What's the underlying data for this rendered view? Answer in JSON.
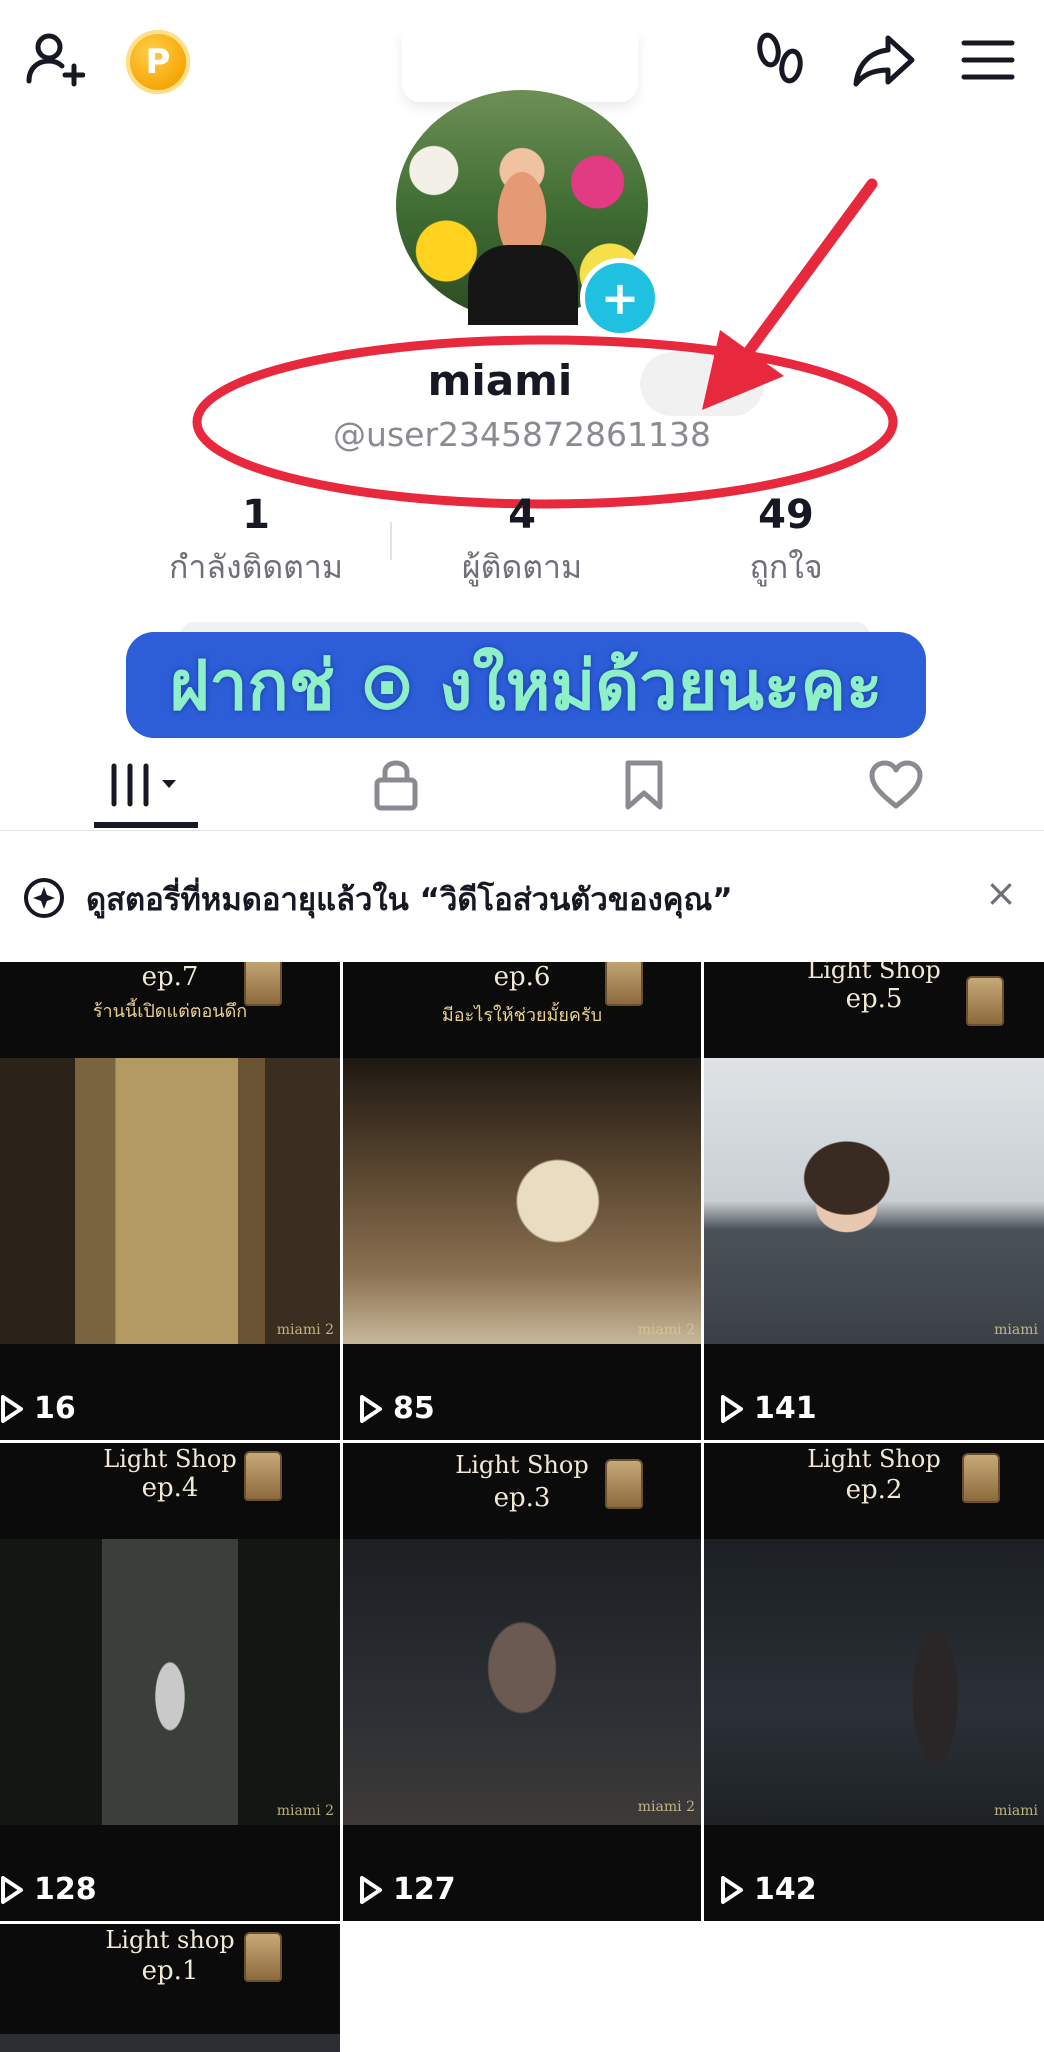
{
  "header": {
    "add_friend_icon": "person-plus-icon",
    "coin_label": "P",
    "footprint_icon": "footprints-icon",
    "share_icon": "share-arrow-icon",
    "menu_icon": "hamburger-menu-icon"
  },
  "profile": {
    "name": "miami",
    "handle": "@user2345872861138",
    "stats": [
      {
        "value": "1",
        "label": "กำลังติดตาม"
      },
      {
        "value": "4",
        "label": "ผู้ติดตาม"
      },
      {
        "value": "49",
        "label": "ถูกใจ"
      }
    ]
  },
  "overlay": {
    "caption": "ฝากช่ ⊙ งใหม่ด้วยนะคะ"
  },
  "tabs": [
    {
      "name": "videos",
      "icon": "grid-icon"
    },
    {
      "name": "private",
      "icon": "lock-icon"
    },
    {
      "name": "saved",
      "icon": "bookmark-icon"
    },
    {
      "name": "liked",
      "icon": "heart-icon"
    }
  ],
  "banner": {
    "text": "ดูสตอรี่ที่หมดอายุแล้วใน “วิดีโอส่วนตัวของคุณ”",
    "close": "×"
  },
  "videos": [
    {
      "line1": "",
      "line2": "ep.7",
      "subtitle": "ร้านนี้เปิดแต่ตอนดึก",
      "watermark": "miami 2",
      "views": "16"
    },
    {
      "line1": "",
      "line2": "ep.6",
      "subtitle": "มีอะไรให้ช่วยมั้ยครับ",
      "watermark": "miami 2",
      "views": "85"
    },
    {
      "line1": "Light Shop",
      "line2": "ep.5",
      "subtitle": "",
      "watermark": "miami",
      "views": "141"
    },
    {
      "line1": "Light Shop",
      "line2": "ep.4",
      "subtitle": "",
      "watermark": "miami 2",
      "views": "128"
    },
    {
      "line1": "Light Shop",
      "line2": "ep.3",
      "subtitle": "",
      "watermark": "miami 2",
      "views": "127"
    },
    {
      "line1": "Light Shop",
      "line2": "ep.2",
      "subtitle": "",
      "watermark": "miami",
      "views": "142"
    },
    {
      "line1": "Light shop",
      "line2": "ep.1",
      "subtitle": "",
      "watermark": "",
      "views": ""
    }
  ],
  "colors": {
    "accent_cyan": "#20c1e0",
    "annotation_red": "#e8283c",
    "caption_bg": "#2d5ed8",
    "caption_text": "#8ef0c8"
  }
}
